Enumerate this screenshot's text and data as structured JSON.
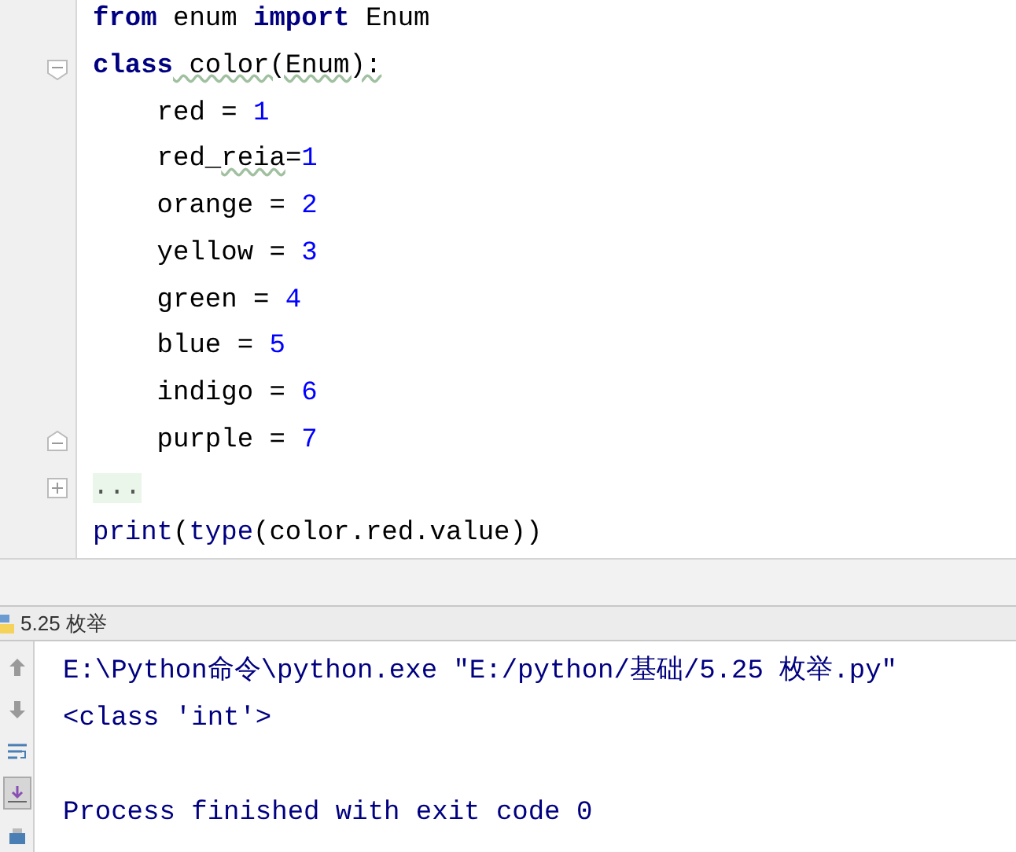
{
  "editor": {
    "lines": [
      {
        "tokens": [
          {
            "text": "from",
            "kind": "keyword"
          },
          {
            "text": " enum ",
            "kind": "plain"
          },
          {
            "text": "import",
            "kind": "keyword"
          },
          {
            "text": " Enum",
            "kind": "plain"
          }
        ]
      },
      {
        "fold": {
          "kind": "start"
        },
        "tokens": [
          {
            "text": "class",
            "kind": "keyword"
          },
          {
            "text": " color(Enum):",
            "kind": "warning"
          }
        ]
      },
      {
        "tokens": [
          {
            "text": "    red = ",
            "kind": "plain"
          },
          {
            "text": "1",
            "kind": "number"
          }
        ]
      },
      {
        "tokens": [
          {
            "text": "    red_",
            "kind": "plain"
          },
          {
            "text": "reia",
            "kind": "warning"
          },
          {
            "text": "=",
            "kind": "plain"
          },
          {
            "text": "1",
            "kind": "number"
          }
        ]
      },
      {
        "tokens": [
          {
            "text": "    orange = ",
            "kind": "plain"
          },
          {
            "text": "2",
            "kind": "number"
          }
        ]
      },
      {
        "tokens": [
          {
            "text": "    yellow = ",
            "kind": "plain"
          },
          {
            "text": "3",
            "kind": "number"
          }
        ]
      },
      {
        "tokens": [
          {
            "text": "    green = ",
            "kind": "plain"
          },
          {
            "text": "4",
            "kind": "number"
          }
        ]
      },
      {
        "tokens": [
          {
            "text": "    blue = ",
            "kind": "plain"
          },
          {
            "text": "5",
            "kind": "number"
          }
        ]
      },
      {
        "tokens": [
          {
            "text": "    indigo = ",
            "kind": "plain"
          },
          {
            "text": "6",
            "kind": "number"
          }
        ]
      },
      {
        "fold": {
          "kind": "end"
        },
        "tokens": [
          {
            "text": "    purple = ",
            "kind": "plain"
          },
          {
            "text": "7",
            "kind": "number"
          }
        ]
      },
      {
        "fold": {
          "kind": "collapsed"
        },
        "tokens": [
          {
            "text": "...",
            "kind": "folded"
          }
        ]
      },
      {
        "tokens": [
          {
            "text": "print",
            "kind": "builtin"
          },
          {
            "text": "(",
            "kind": "plain"
          },
          {
            "text": "type",
            "kind": "builtin"
          },
          {
            "text": "(color.red.value))",
            "kind": "plain"
          }
        ]
      }
    ]
  },
  "run_panel": {
    "title": "5.25 枚举",
    "toolbar": [
      {
        "kind": "up",
        "on": false
      },
      {
        "kind": "down",
        "on": false
      },
      {
        "kind": "wrap",
        "on": false
      },
      {
        "kind": "scroll-end",
        "on": true
      },
      {
        "kind": "print",
        "on": false
      }
    ],
    "console": [
      {
        "text": "E:\\Python命令\\python.exe \"E:/python/基础/5.25 枚举.py\"",
        "kind": "command"
      },
      {
        "text": "<class 'int'>",
        "kind": "output"
      },
      {
        "text": "Process finished with exit code 0",
        "kind": "status"
      }
    ]
  }
}
